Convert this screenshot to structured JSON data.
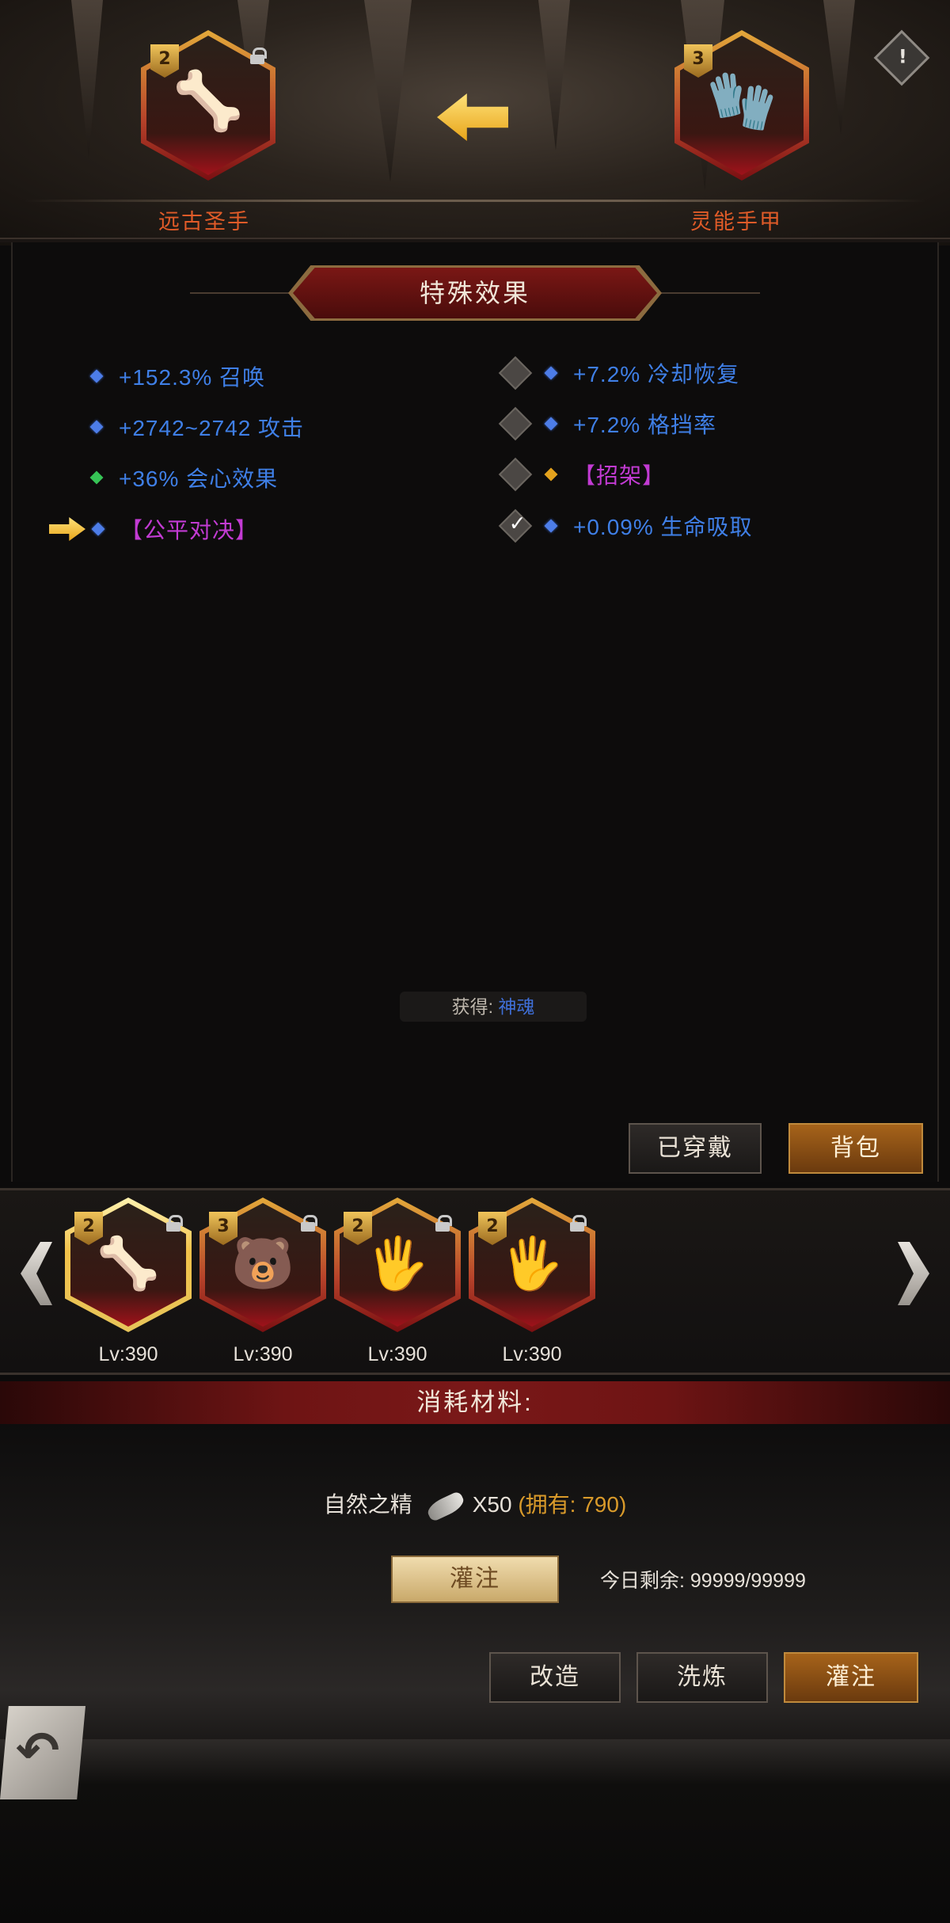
{
  "header": {
    "left_item": {
      "name": "远古圣手",
      "tier": "2",
      "icon": "claw-icon"
    },
    "right_item": {
      "name": "灵能手甲",
      "tier": "3",
      "icon": "gauntlet-icon"
    },
    "transfer_icon": "arrow-left-icon",
    "info_label": "!"
  },
  "effects": {
    "title": "特殊效果",
    "left": [
      {
        "gem": "blue",
        "text": "+152.3% 召唤"
      },
      {
        "gem": "blue",
        "text": "+2742~2742 攻击"
      },
      {
        "gem": "green",
        "text": "+36% 会心效果"
      },
      {
        "gem": "blue",
        "text": "【公平对决】",
        "highlight": true
      }
    ],
    "right": [
      {
        "gem": "blue",
        "text": "+7.2% 冷却恢复",
        "locked": false
      },
      {
        "gem": "blue",
        "text": "+7.2% 格挡率",
        "locked": false
      },
      {
        "gem": "gold",
        "text": "【招架】",
        "locked": false
      },
      {
        "gem": "blue",
        "text": "+0.09% 生命吸取",
        "locked": true
      }
    ]
  },
  "source": {
    "label": "获得:",
    "value": "神魂"
  },
  "panel_buttons": {
    "equipped": "已穿戴",
    "backpack": "背包"
  },
  "carousel": {
    "items": [
      {
        "tier": "2",
        "level": "Lv:390",
        "icon": "claw-icon",
        "selected": true
      },
      {
        "tier": "3",
        "level": "Lv:390",
        "icon": "bear-head-icon",
        "selected": false
      },
      {
        "tier": "2",
        "level": "Lv:390",
        "icon": "purple-gauntlet-icon",
        "selected": false
      },
      {
        "tier": "2",
        "level": "Lv:390",
        "icon": "purple-gauntlet-icon",
        "selected": false
      }
    ]
  },
  "materials": {
    "header": "消耗材料:",
    "name": "自然之精",
    "qty": "X50",
    "owned": "(拥有: 790)",
    "infuse_button": "灌注",
    "remaining_label": "今日剩余:",
    "remaining_value": "99999/99999"
  },
  "actions": {
    "reforge": "改造",
    "refine": "洗炼",
    "infuse": "灌注"
  },
  "colors": {
    "stat_blue": "#3f7fe6",
    "stat_purple": "#c23bd3",
    "item_name": "#e05b28",
    "owned_gold": "#d99a2a"
  }
}
